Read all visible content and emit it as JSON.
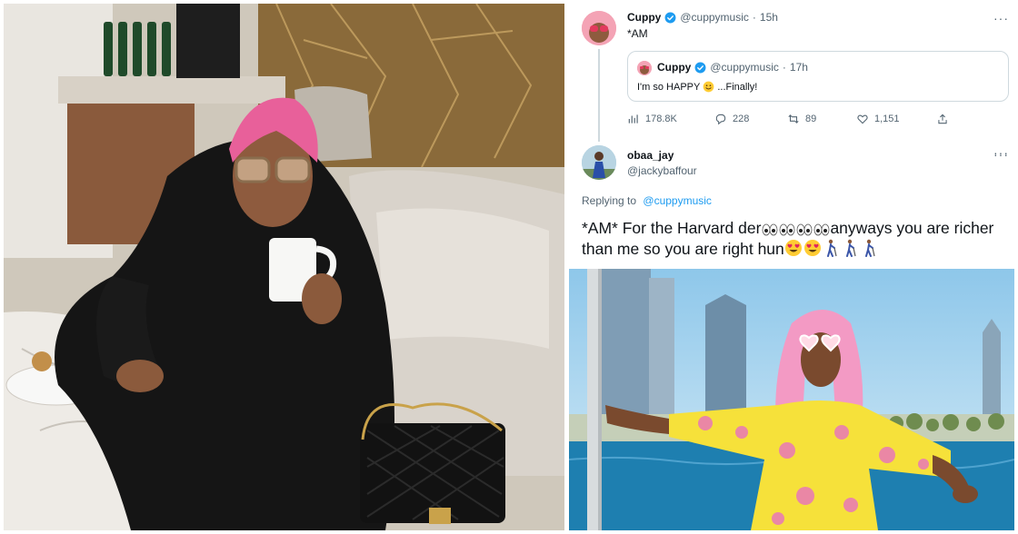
{
  "left_photo": {
    "alt": ""
  },
  "quoting_tweet": {
    "name": "Cuppy",
    "handle": "@cuppymusic",
    "separator": "·",
    "time": "15h",
    "text": "*AM",
    "quoted_tweet": {
      "name": "Cuppy",
      "handle": "@cuppymusic",
      "separator": "·",
      "time": "17h",
      "text_before": "I'm so HAPPY",
      "text_after": "...Finally!"
    },
    "actions": {
      "views": "178.8K",
      "replies": "228",
      "retweets": "89",
      "likes": "1,151"
    },
    "more": "···"
  },
  "reply_tweet": {
    "name": "obaa_jay",
    "handle": "@jackybaffour",
    "more": "···",
    "replying_prefix": "Replying to",
    "replying_handle": "@cuppymusic",
    "text_part1": "*AM* For the Harvard der",
    "text_part2": "anyways you are richer than me so you are right hun"
  },
  "colors": {
    "link": "#1d9bf0",
    "secondary_text": "#536471",
    "border": "#cfd9de",
    "verified": "#1d9bf0"
  },
  "icons": [
    "verified-badge-icon",
    "views-icon",
    "reply-icon",
    "retweet-icon",
    "like-icon",
    "share-icon",
    "eyes-emoji-icon",
    "heart-eyes-emoji-icon",
    "person-with-cane-emoji-icon",
    "smiley-emoji-icon"
  ]
}
